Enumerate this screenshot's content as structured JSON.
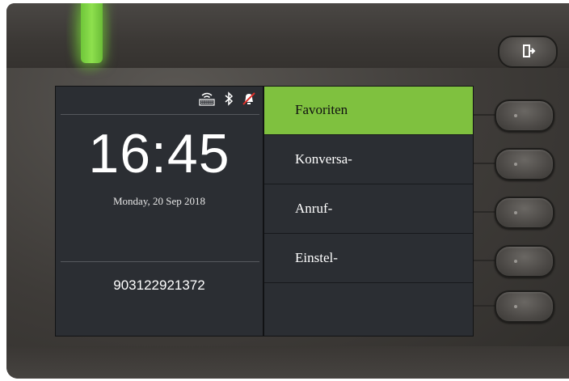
{
  "status_bar": {
    "icons": [
      "wlan-icon",
      "bluetooth-icon",
      "ringer-off-icon"
    ]
  },
  "home": {
    "time": "16:45",
    "date": "Monday, 20 Sep 2018",
    "phone_number": "903122921372"
  },
  "menu": {
    "items": [
      {
        "label": "Favoriten",
        "selected": true
      },
      {
        "label": "Konversa-",
        "selected": false
      },
      {
        "label": "Anruf-",
        "selected": false
      },
      {
        "label": "Einstel-",
        "selected": false
      },
      {
        "label": "",
        "selected": false
      }
    ]
  },
  "hardware": {
    "exit_icon": "exit-icon",
    "led_color": "#7fd43f"
  },
  "colors": {
    "accent": "#7fc13f",
    "screen_bg": "#2b2e33"
  }
}
